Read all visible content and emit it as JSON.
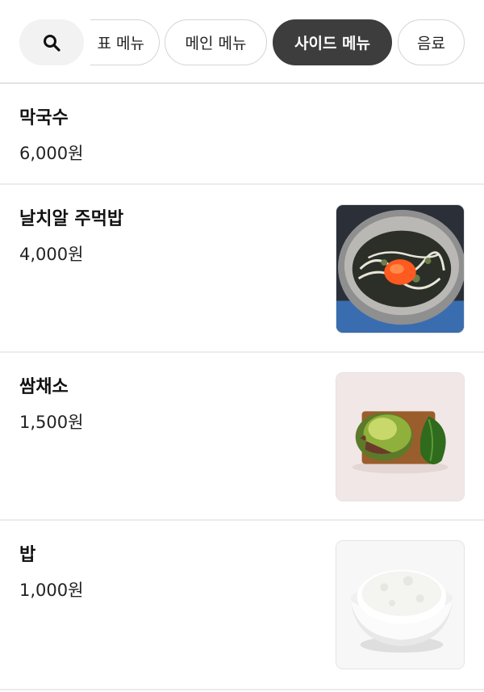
{
  "tabs": [
    {
      "label": "표 메뉴",
      "selected": false
    },
    {
      "label": "메인 메뉴",
      "selected": false
    },
    {
      "label": "사이드 메뉴",
      "selected": true
    },
    {
      "label": "음료",
      "selected": false
    }
  ],
  "search": {
    "icon": "search-icon"
  },
  "items": [
    {
      "name": "막국수",
      "price": "6,000원",
      "image": null
    },
    {
      "name": "날치알 주먹밥",
      "price": "4,000원",
      "image": "rice-ball-photo"
    },
    {
      "name": "쌈채소",
      "price": "1,500원",
      "image": "lettuce-wraps-photo"
    },
    {
      "name": "밥",
      "price": "1,000원",
      "image": "rice-bowl-photo"
    }
  ],
  "colors": {
    "selected_tab_bg": "#3d3d3d",
    "divider": "#ececec"
  }
}
